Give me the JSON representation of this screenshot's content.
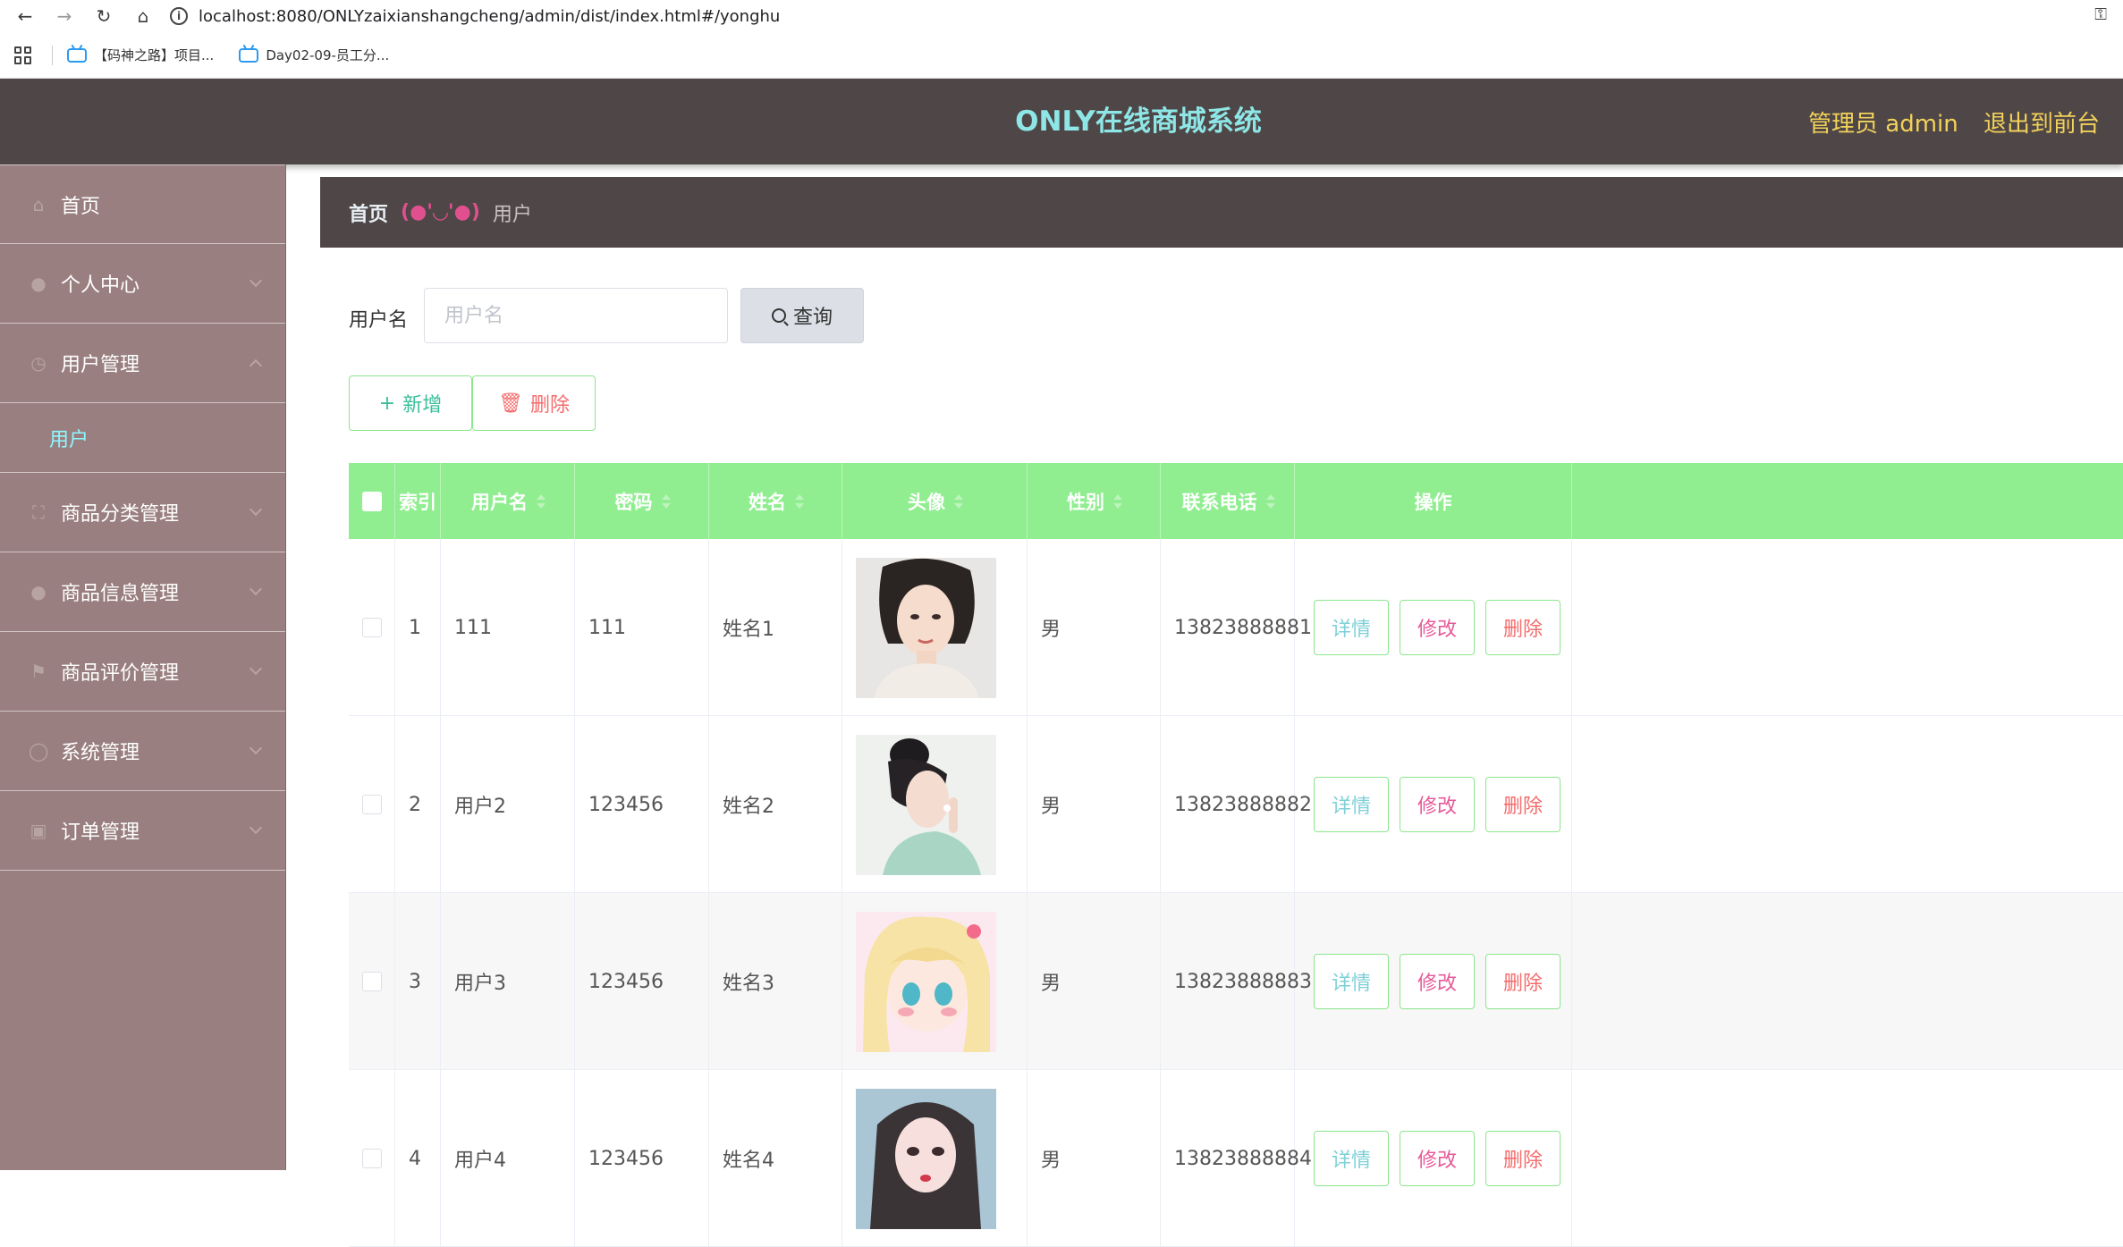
{
  "browser": {
    "url": "localhost:8080/ONLYzaixianshangcheng/admin/dist/index.html#/yonghu",
    "bookmarks": [
      "【码神之路】项目...",
      "Day02-09-员工分..."
    ]
  },
  "header": {
    "title": "ONLY在线商城系统",
    "admin_label": "管理员 admin",
    "exit_label": "退出到前台"
  },
  "sidebar": {
    "items": [
      {
        "label": "首页",
        "icon": "home-icon"
      },
      {
        "label": "个人中心",
        "icon": "user-icon"
      },
      {
        "label": "用户管理",
        "icon": "clock-icon"
      },
      {
        "label": "商品分类管理",
        "icon": "fullscreen-icon"
      },
      {
        "label": "商品信息管理",
        "icon": "mic-icon"
      },
      {
        "label": "商品评价管理",
        "icon": "flag-icon"
      },
      {
        "label": "系统管理",
        "icon": "globe-icon"
      },
      {
        "label": "订单管理",
        "icon": "chart-icon"
      }
    ],
    "submenu_active": "用户"
  },
  "breadcrumb": {
    "home": "首页",
    "separator": "(●'◡'●)",
    "current": "用户"
  },
  "search": {
    "label": "用户名",
    "placeholder": "用户名",
    "button": "查询"
  },
  "actions": {
    "add": "新增",
    "delete": "删除"
  },
  "table": {
    "headers": [
      "索引",
      "用户名",
      "密码",
      "姓名",
      "头像",
      "性别",
      "联系电话",
      "操作"
    ],
    "rows": [
      {
        "index": "1",
        "username": "111",
        "password": "111",
        "name": "姓名1",
        "gender": "男",
        "phone": "13823888881"
      },
      {
        "index": "2",
        "username": "用户2",
        "password": "123456",
        "name": "姓名2",
        "gender": "男",
        "phone": "13823888882"
      },
      {
        "index": "3",
        "username": "用户3",
        "password": "123456",
        "name": "姓名3",
        "gender": "男",
        "phone": "13823888883"
      },
      {
        "index": "4",
        "username": "用户4",
        "password": "123456",
        "name": "姓名4",
        "gender": "男",
        "phone": "13823888884"
      }
    ],
    "row_actions": {
      "detail": "详情",
      "edit": "修改",
      "delete": "删除"
    }
  },
  "colors": {
    "header_bg": "#4f4747",
    "sidebar_bg": "#9a7f80",
    "title": "#8ee6e6",
    "header_links": "#f3d25a",
    "table_head": "#90ee90",
    "active_submenu": "#8ff7ff"
  }
}
